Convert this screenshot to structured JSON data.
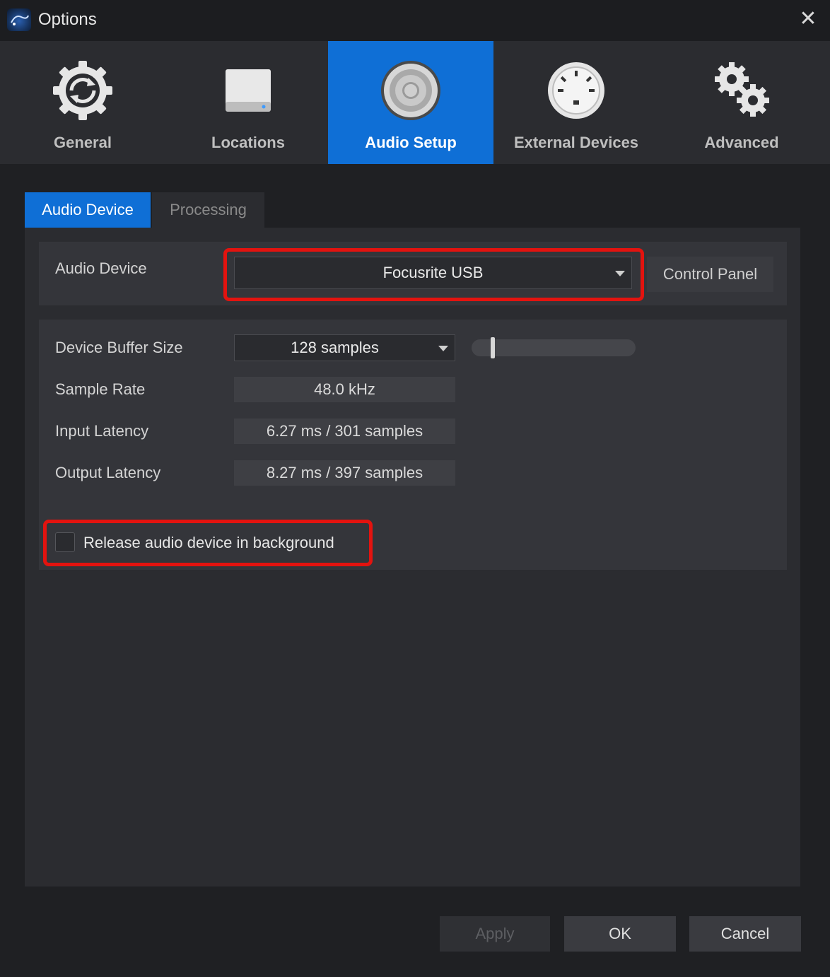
{
  "window": {
    "title": "Options",
    "close_symbol": "✕"
  },
  "categories": [
    {
      "label": "General",
      "icon": "gear-sync-icon"
    },
    {
      "label": "Locations",
      "icon": "drive-icon"
    },
    {
      "label": "Audio Setup",
      "icon": "speaker-icon",
      "active": true
    },
    {
      "label": "External Devices",
      "icon": "midi-port-icon"
    },
    {
      "label": "Advanced",
      "icon": "gears-icon"
    }
  ],
  "tabs": [
    {
      "label": "Audio Device",
      "active": true
    },
    {
      "label": "Processing",
      "active": false
    }
  ],
  "audio_device": {
    "label": "Audio Device",
    "selected": "Focusrite USB",
    "control_panel_label": "Control Panel"
  },
  "settings": {
    "buffer_label": "Device Buffer Size",
    "buffer_value": "128 samples",
    "buffer_slider_level": 0.12,
    "sample_rate_label": "Sample Rate",
    "sample_rate_value": "48.0 kHz",
    "input_latency_label": "Input Latency",
    "input_latency_value": "6.27 ms / 301 samples",
    "output_latency_label": "Output Latency",
    "output_latency_value": "8.27 ms / 397 samples",
    "release_label": "Release audio device in background",
    "release_checked": false
  },
  "buttons": {
    "apply": "Apply",
    "ok": "OK",
    "cancel": "Cancel"
  },
  "colors": {
    "accent": "#0f6fd6",
    "highlight": "#e3130f"
  }
}
